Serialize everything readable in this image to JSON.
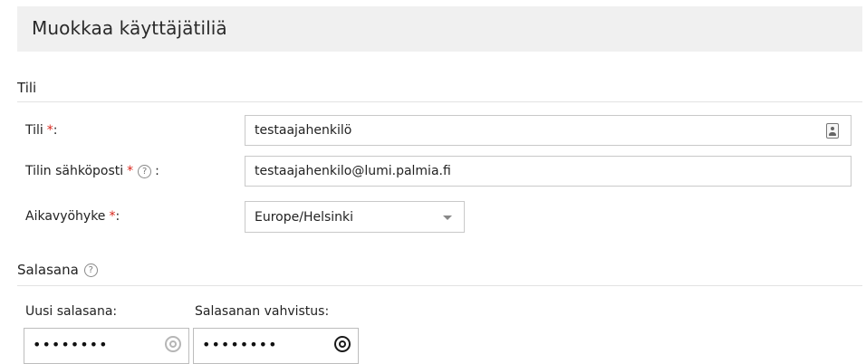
{
  "page": {
    "title": "Muokkaa käyttäjätiliä"
  },
  "sections": {
    "account": {
      "title": "Tili"
    },
    "password": {
      "title": "Salasana"
    }
  },
  "fields": {
    "account": {
      "label": "Tili",
      "required_marker": "*",
      "suffix": ":",
      "value": "testaajahenkilö",
      "icon": "contact-card-icon"
    },
    "email": {
      "label": "Tilin sähköposti",
      "required_marker": "*",
      "help_icon": "?",
      "suffix": ":",
      "value": "testaajahenkilo@lumi.palmia.fi"
    },
    "timezone": {
      "label": "Aikavyöhyke",
      "required_marker": "*",
      "suffix": ":",
      "selected": "Europe/Helsinki",
      "icon": "chevron-down-icon"
    },
    "new_password": {
      "label": "Uusi salasana:",
      "masked_value": "••••••••",
      "icon": "eye-icon"
    },
    "confirm_password": {
      "label": "Salasanan vahvistus:",
      "masked_value": "••••••••",
      "icon": "eye-icon"
    }
  },
  "colors": {
    "required": "#d9261c",
    "header_bg": "#f0f0f0",
    "border": "#c9c9c9"
  }
}
